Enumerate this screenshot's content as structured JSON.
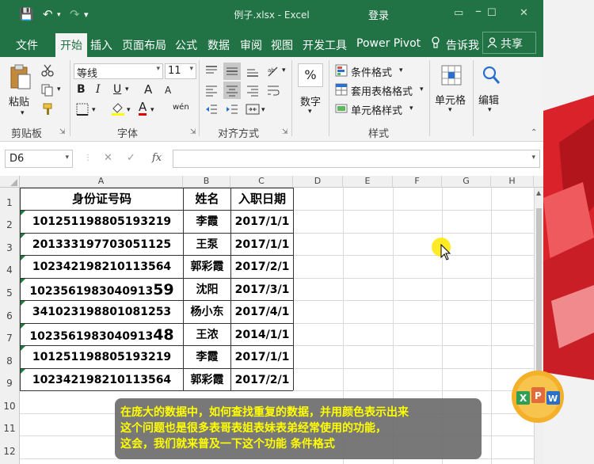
{
  "window": {
    "file_title": "例子.xlsx",
    "app_name": "Excel",
    "title_sep": " - ",
    "login": "登录",
    "min": "▭",
    "max": "☐",
    "close": "✕",
    "qa_save": "💾",
    "qa_undo": "↶",
    "qa_redo": "↷",
    "qa_more": "⩤"
  },
  "tabs": [
    "文件",
    "开始",
    "插入",
    "页面布局",
    "公式",
    "数据",
    "审阅",
    "视图",
    "开发工具",
    "Power Pivot",
    "告诉我",
    "共享"
  ],
  "ribbon": {
    "clipboard": {
      "paste": "粘贴",
      "label": "剪贴板"
    },
    "font": {
      "name": "等线",
      "size": "11",
      "bold": "B",
      "italic": "I",
      "underline": "U",
      "grow": "A",
      "shrink": "A",
      "font_color": "A",
      "phonetic": "wén",
      "label": "字体"
    },
    "align": {
      "label": "对齐方式"
    },
    "number": {
      "caption": "数字",
      "symbol": "%"
    },
    "styles": {
      "cond": "条件格式",
      "table": "套用表格格式",
      "cell_style": "单元格样式",
      "label": "样式"
    },
    "cells": {
      "caption": "单元格"
    },
    "edit": {
      "caption": "编辑"
    },
    "dropdown": "▾",
    "launcher": "⇲"
  },
  "formula_bar": {
    "name_box": "D6",
    "cancel": "✕",
    "enter": "✓",
    "fx": "fx",
    "value": ""
  },
  "columns": [
    "A",
    "B",
    "C",
    "D",
    "E",
    "F",
    "G",
    "H"
  ],
  "rows": [
    "1",
    "2",
    "3",
    "4",
    "5",
    "6",
    "7",
    "8",
    "9",
    "10",
    "11",
    "12"
  ],
  "table": {
    "headers": [
      "身份证号码",
      "姓名",
      "入职日期"
    ],
    "rows": [
      {
        "id": "101251198805193219",
        "name": "李霞",
        "date": "2017/1/1"
      },
      {
        "id": "201333197703051125",
        "name": "王泵",
        "date": "2017/1/1"
      },
      {
        "id": "102342198210113564",
        "name": "郭彩霞",
        "date": "2017/2/1"
      },
      {
        "id_main": "1023561983040913",
        "id_tail": "59",
        "name": "沈阳",
        "date": "2017/3/1"
      },
      {
        "id": "341023198801081253",
        "name": "杨小东",
        "date": "2017/4/1"
      },
      {
        "id_main": "1023561983040913",
        "id_tail": "48",
        "name": "王浓",
        "date": "2014/1/1"
      },
      {
        "id": "101251198805193219",
        "name": "李霞",
        "date": "2017/1/1"
      },
      {
        "id": "102342198210113564",
        "name": "郭彩霞",
        "date": "2017/2/1"
      }
    ]
  },
  "caption": [
    "在庞大的数据中，如何查找重复的数据，并用颜色表示出来",
    "这个问题也是很多表哥表姐表妹表弟经常使用的功能，",
    "这会，我们就来普及一下这个功能 条件格式"
  ],
  "colors": {
    "excel_green": "#217346",
    "caption_text": "#ffff00",
    "cursor_highlight": "#ffe600"
  }
}
